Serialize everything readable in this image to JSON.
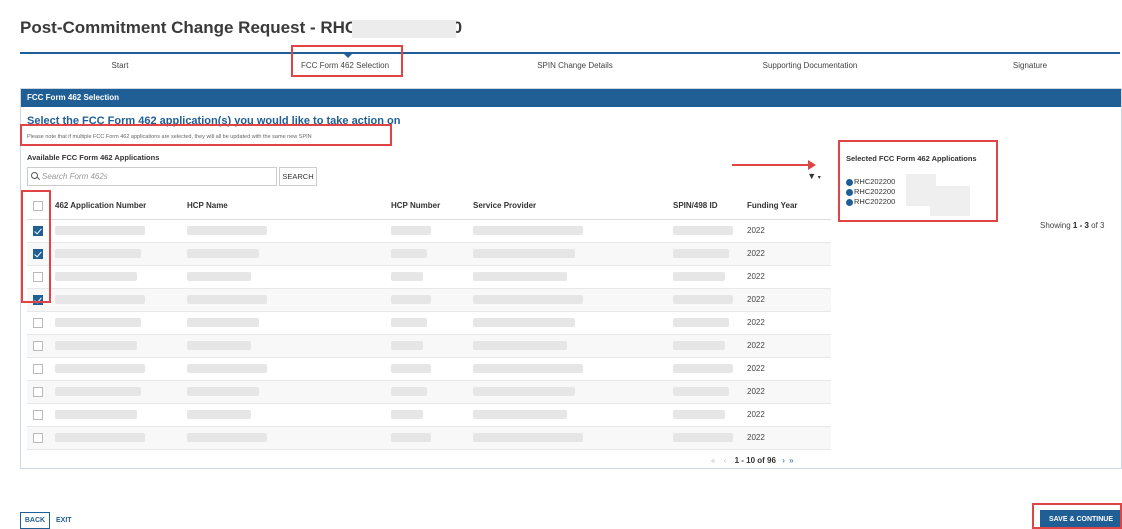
{
  "page": {
    "title": "Post-Commitment Change Request - RHC_PCCR20230"
  },
  "stepper": {
    "steps": [
      {
        "label": "Start"
      },
      {
        "label": "FCC Form 462 Selection"
      },
      {
        "label": "SPIN Change Details"
      },
      {
        "label": "Supporting Documentation"
      },
      {
        "label": "Signature"
      }
    ],
    "active_index": 1
  },
  "panel": {
    "header": "FCC Form 462 Selection",
    "subtitle": "Select the FCC Form 462 application(s) you would like to take action on",
    "note": "Please note that if multiple FCC Form 462 applications are selected, they will all be updated with the same new SPIN",
    "available_title": "Available FCC Form 462 Applications",
    "search_placeholder": "Search Form 462s",
    "search_button": "SEARCH"
  },
  "table": {
    "columns": [
      "462 Application Number",
      "HCP Name",
      "HCP Number",
      "Service Provider",
      "SPIN/498 ID",
      "Funding Year"
    ],
    "rows": [
      {
        "checked": true,
        "funding_year": "2022"
      },
      {
        "checked": true,
        "funding_year": "2022"
      },
      {
        "checked": false,
        "funding_year": "2022"
      },
      {
        "checked": true,
        "funding_year": "2022"
      },
      {
        "checked": false,
        "funding_year": "2022"
      },
      {
        "checked": false,
        "funding_year": "2022"
      },
      {
        "checked": false,
        "funding_year": "2022"
      },
      {
        "checked": false,
        "funding_year": "2022"
      },
      {
        "checked": false,
        "funding_year": "2022"
      },
      {
        "checked": false,
        "funding_year": "2022"
      }
    ],
    "pagination": "1 - 10 of 96"
  },
  "selected": {
    "title": "Selected FCC Form 462 Applications",
    "items": [
      "RHC202200",
      "RHC202200",
      "RHC202200"
    ],
    "showing_prefix": "Showing ",
    "showing_range": "1 - 3",
    "showing_suffix": " of 3"
  },
  "footer": {
    "back": "BACK",
    "exit": "EXIT",
    "save": "SAVE & CONTINUE"
  },
  "colors": {
    "brand_blue": "#1f5f95",
    "highlight_red": "#e04444"
  }
}
